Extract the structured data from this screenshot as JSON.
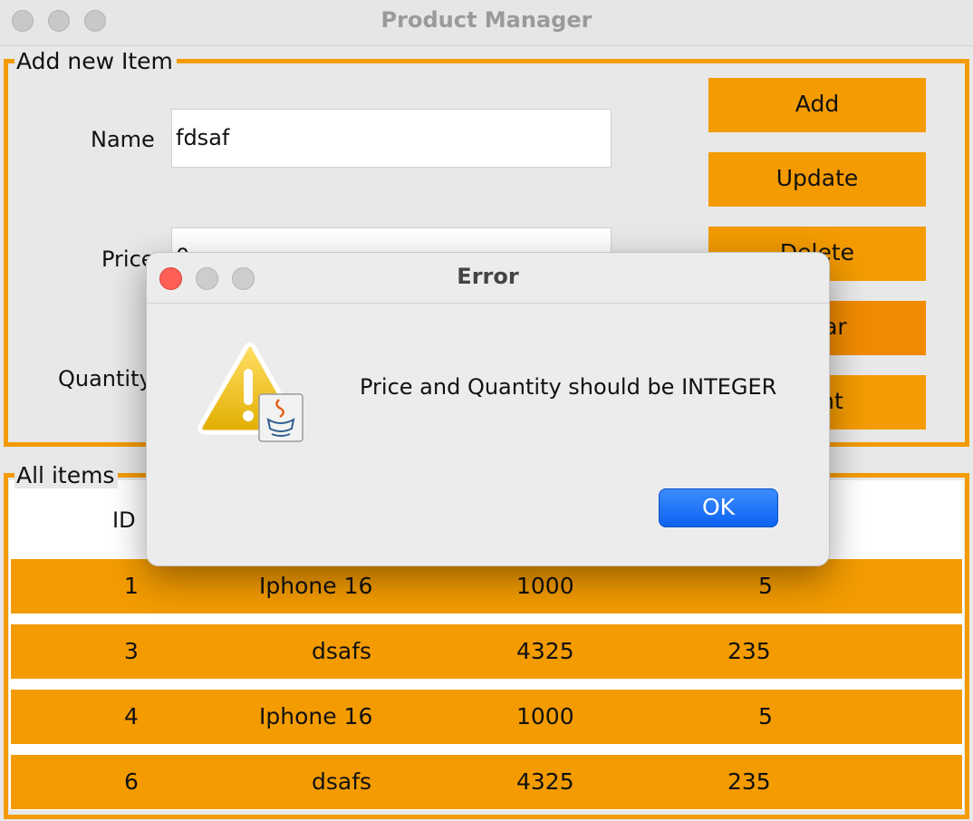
{
  "window": {
    "title": "Product Manager"
  },
  "form": {
    "group_label": "Add new Item",
    "name_label": "Name",
    "name_value": "fdsaf",
    "price_label": "Price",
    "price_value": "0",
    "quantity_label": "Quantity",
    "buttons": {
      "add": "Add",
      "update": "Update",
      "delete": "Delete",
      "clear": "Clear",
      "print": "Print"
    }
  },
  "table": {
    "group_label": "All items",
    "headers": {
      "id": "ID"
    },
    "rows": [
      {
        "id": "1",
        "name": "Iphone 16",
        "price": "1000",
        "quantity": "5"
      },
      {
        "id": "3",
        "name": "dsafs",
        "price": "4325",
        "quantity": "235"
      },
      {
        "id": "4",
        "name": "Iphone 16",
        "price": "1000",
        "quantity": "5"
      },
      {
        "id": "6",
        "name": "dsafs",
        "price": "4325",
        "quantity": "235"
      }
    ]
  },
  "dialog": {
    "title": "Error",
    "message": "Price and Quantity should be INTEGER",
    "ok_label": "OK",
    "icon": "warning-icon"
  },
  "colors": {
    "accent": "#f39b00",
    "dialog_button": "#1a6ff5",
    "traffic_close": "#fe5f57"
  }
}
